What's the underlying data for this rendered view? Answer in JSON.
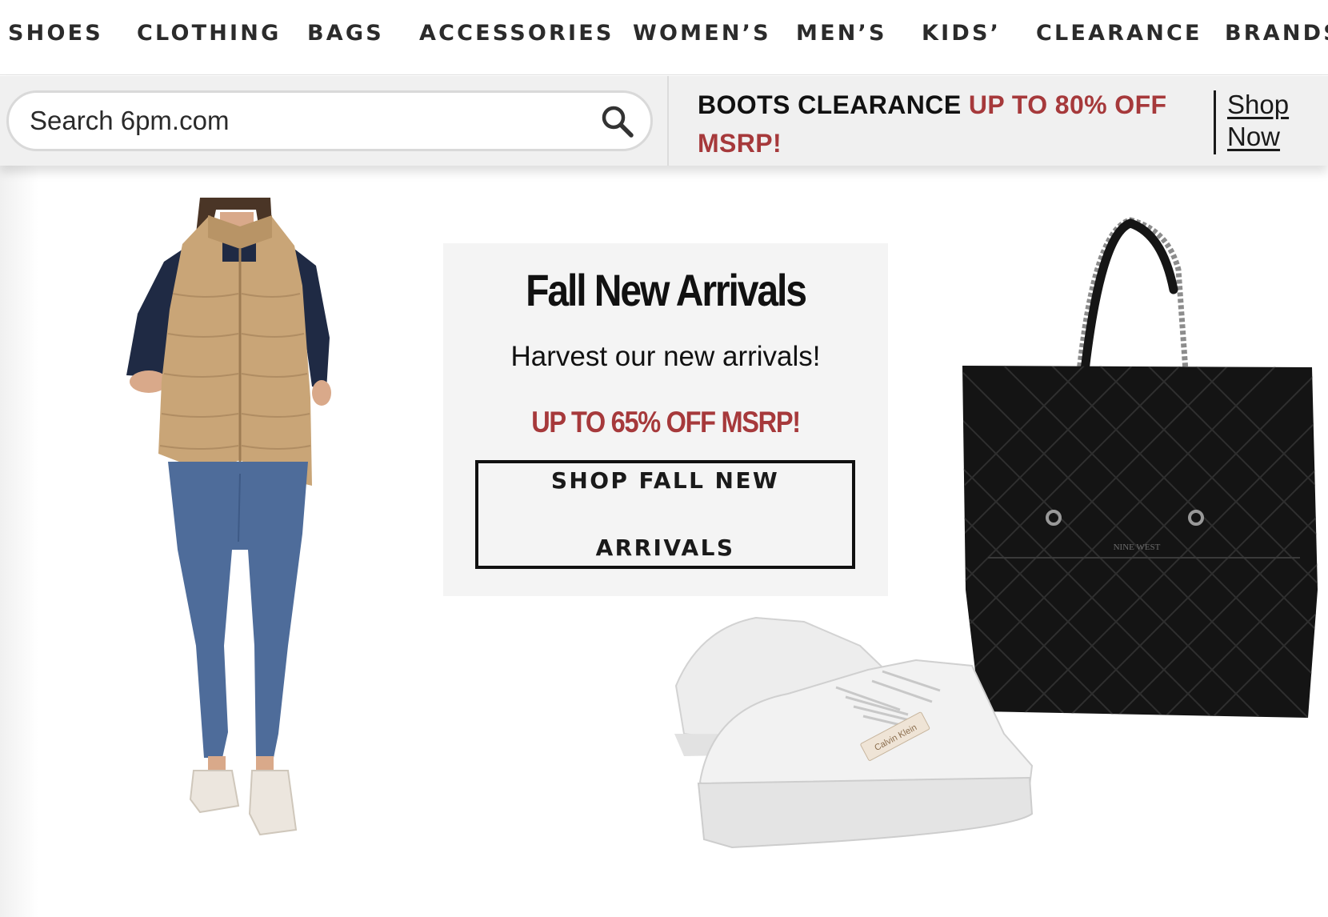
{
  "nav": {
    "items": [
      {
        "label": "SHOES",
        "name": "nav-item-shoes"
      },
      {
        "label": "CLOTHING",
        "name": "nav-item-clothing"
      },
      {
        "label": "BAGS",
        "name": "nav-item-bags"
      },
      {
        "label": "ACCESSORIES",
        "name": "nav-item-accessories"
      },
      {
        "label": "WOMEN’S",
        "name": "nav-item-womens"
      },
      {
        "label": "MEN’S",
        "name": "nav-item-mens"
      },
      {
        "label": "KIDS’",
        "name": "nav-item-kids"
      },
      {
        "label": "CLEARANCE",
        "name": "nav-item-clearance"
      },
      {
        "label": "BRANDS",
        "name": "nav-item-brands"
      }
    ]
  },
  "search": {
    "placeholder": "Search 6pm.com",
    "icon": "search-icon"
  },
  "promo_bar": {
    "lead": "BOOTS CLEARANCE ",
    "highlight": "UP TO 80% OFF MSRP!",
    "link_line1": "Shop",
    "link_line2": "Now"
  },
  "hero": {
    "title": "Fall New Arrivals",
    "subtitle": "Harvest our new arrivals!",
    "discount": "UP TO 65% OFF MSRP!",
    "button_line1": "SHOP FALL NEW",
    "button_line2": "ARRIVALS",
    "sneaker_brand": "Calvin Klein",
    "bag_brand": "NINE WEST"
  },
  "colors": {
    "accent_red": "#a6393b",
    "text_dark": "#111111",
    "bar_bg": "#f0f0f0",
    "card_bg": "#f4f4f4"
  }
}
